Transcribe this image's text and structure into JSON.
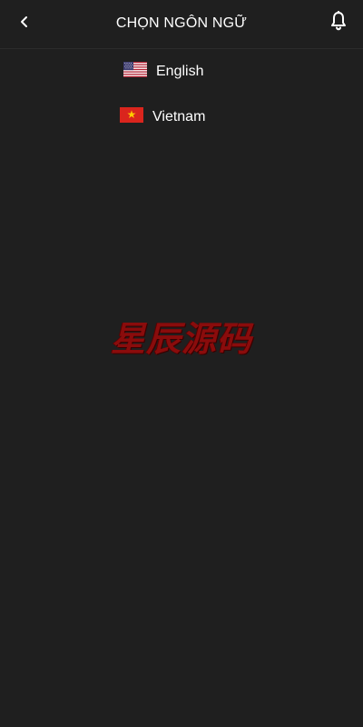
{
  "header": {
    "title": "CHỌN NGÔN NGỮ",
    "back_icon": "chevron-left-icon",
    "notification_icon": "bell-icon"
  },
  "languages": [
    {
      "label": "English",
      "flag": "us-flag-icon"
    },
    {
      "label": "Vietnam",
      "flag": "vn-flag-icon"
    }
  ],
  "watermark": {
    "text": "星辰源码",
    "color": "#8a0c0c"
  },
  "colors": {
    "background": "#1f1f1f",
    "text": "#ffffff",
    "divider": "#2c2c2c"
  }
}
